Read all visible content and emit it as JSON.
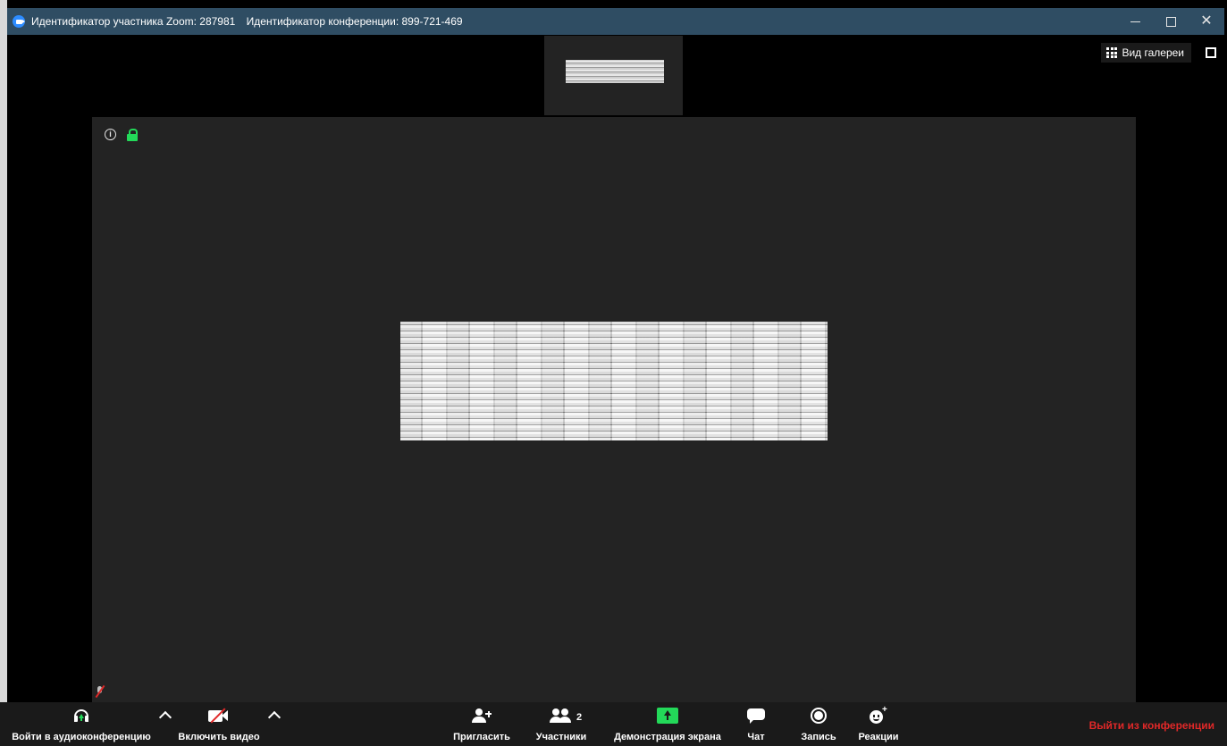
{
  "window": {
    "participant_id": "Идентификатор участника Zoom: 287981",
    "meeting_id": "Идентификатор конференции: 899-721-469"
  },
  "view": {
    "gallery_label": "Вид галереи"
  },
  "toolbar": {
    "join_audio_label": "Войти в аудиоконференцию",
    "start_video_label": "Включить видео",
    "invite_label": "Пригласить",
    "participants_label": "Участники",
    "participants_count": "2",
    "share_screen_label": "Демонстрация экрана",
    "chat_label": "Чат",
    "record_label": "Запись",
    "reactions_label": "Реакции",
    "leave_label": "Выйти из конференции"
  },
  "colors": {
    "titlebar": "#2f4d63",
    "accent_green": "#23d959",
    "leave_red": "#e02828",
    "stage_bg": "#232323",
    "toolbar_bg": "#1a1a1a"
  }
}
